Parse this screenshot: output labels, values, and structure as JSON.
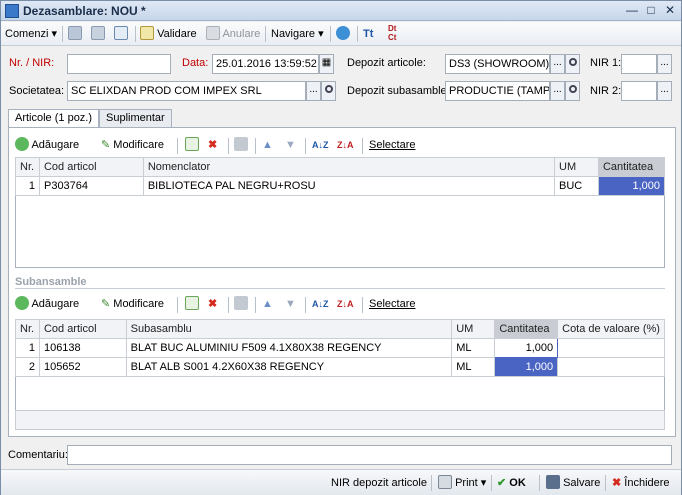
{
  "window": {
    "title": "Dezasamblare: NOU *"
  },
  "toolbar": {
    "comenzi": "Comenzi",
    "validare": "Validare",
    "anulare": "Anulare",
    "navigare": "Navigare",
    "tt": "Tt",
    "dc": "Dt\nCt"
  },
  "header": {
    "nr_nir_label": "Nr. / NIR:",
    "nr_nir_value": "",
    "data_label": "Data:",
    "data_value": "25.01.2016 13:59:52",
    "depozit_articole_label": "Depozit articole:",
    "depozit_articole_value": "DS3 (SHOWROOM)",
    "nir1_label": "NIR 1:",
    "nir1_value": "",
    "societatea_label": "Societatea:",
    "societatea_value": "SC ELIXDAN PROD COM IMPEX SRL",
    "depozit_subansamble_label": "Depozit subasamble:",
    "depozit_subansamble_value": "PRODUCTIE (TAMP",
    "nir2_label": "NIR 2:",
    "nir2_value": ""
  },
  "tabs": [
    {
      "label": "Articole (1 poz.)"
    },
    {
      "label": "Suplimentar"
    }
  ],
  "articole": {
    "actions": {
      "add": "Adăugare",
      "edit": "Modificare",
      "select": "Selectare"
    },
    "columns": [
      "Nr.",
      "Cod articol",
      "Nomenclator",
      "UM",
      "Cantitatea"
    ],
    "rows": [
      {
        "nr": "1",
        "cod": "P303764",
        "nomenclator": "BIBLIOTECA PAL NEGRU+ROSU",
        "um": "BUC",
        "cantitatea": "1,000"
      }
    ]
  },
  "subansamble": {
    "section_title": "Subansamble",
    "actions": {
      "add": "Adăugare",
      "edit": "Modificare",
      "select": "Selectare"
    },
    "columns": [
      "Nr.",
      "Cod articol",
      "Subasamblu",
      "UM",
      "Cantitatea",
      "Cota de valoare (%)"
    ],
    "rows": [
      {
        "nr": "1",
        "cod": "106138",
        "subasamblu": "BLAT BUC ALUMINIU F509 4.1X80X38 REGENCY",
        "um": "ML",
        "cantitatea": "1,000",
        "cota": ""
      },
      {
        "nr": "2",
        "cod": "105652",
        "subasamblu": "BLAT ALB S001 4.2X60X38 REGENCY",
        "um": "ML",
        "cantitatea": "1,000",
        "cota": ""
      }
    ]
  },
  "comentariu": {
    "label": "Comentariu:",
    "value": ""
  },
  "statusbar": {
    "nir_depozit": "NIR depozit articole",
    "print": "Print",
    "ok": "OK",
    "salvare": "Salvare",
    "inchidere": "Închidere"
  },
  "colors": {
    "accent": "#4a64c4",
    "title_bar": "#c7d6ea",
    "required_label": "#c00000"
  }
}
